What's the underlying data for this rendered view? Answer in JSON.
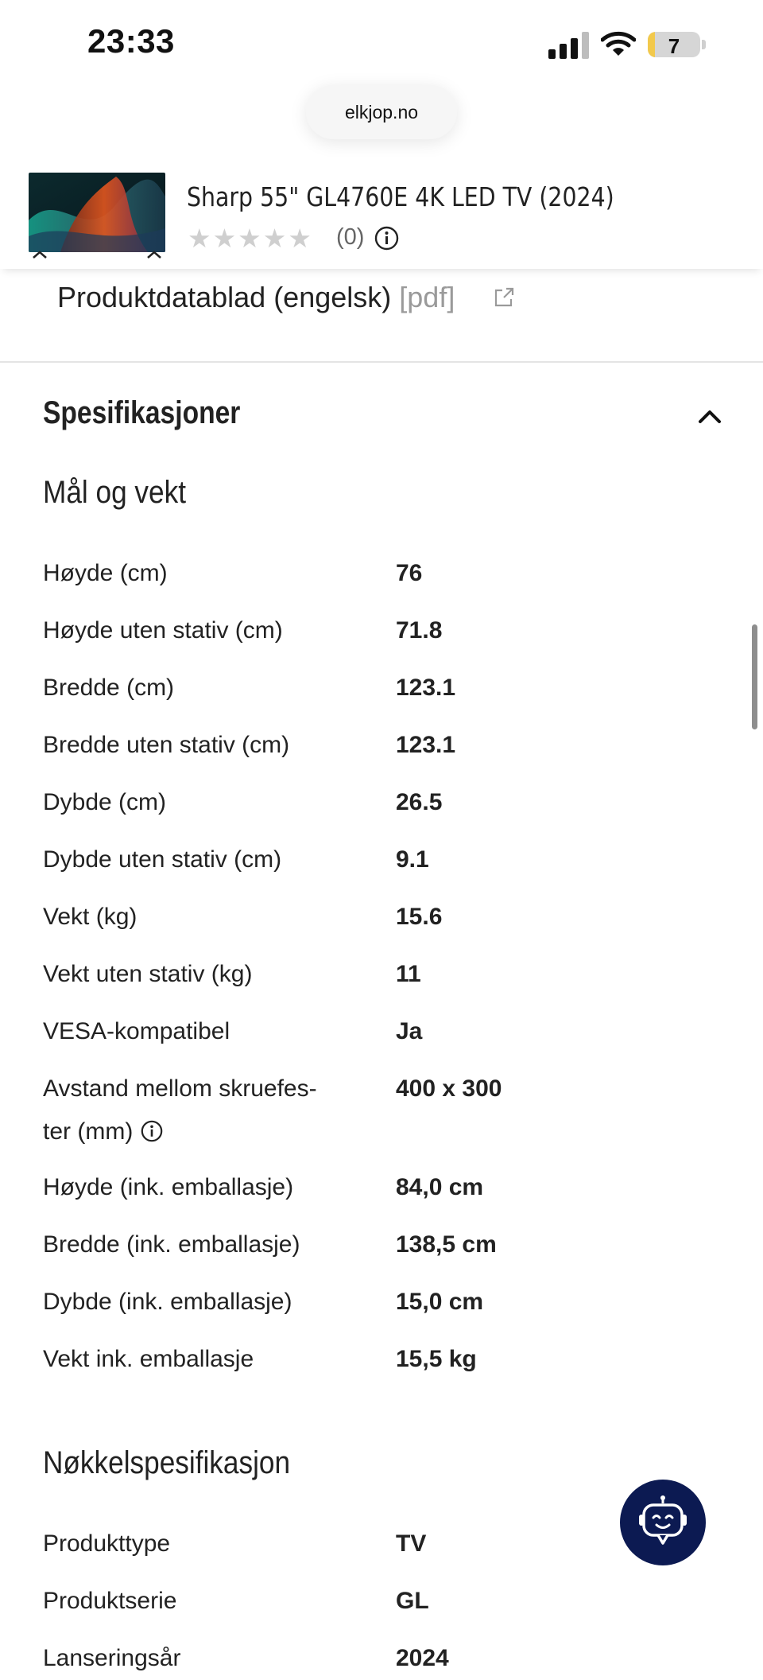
{
  "status_bar": {
    "time": "23:33",
    "battery": "7"
  },
  "browser": {
    "url": "elkjop.no"
  },
  "product": {
    "title": "Sharp 55\" GL4760E 4K LED TV (2024)",
    "stars": "★★★★★",
    "rating_count": "(0)"
  },
  "datasheet": {
    "label": "Produktdatablad (engelsk)",
    "format": "[pdf]"
  },
  "section": {
    "title": "Spesifikasjoner"
  },
  "groups": [
    {
      "title": "Mål og vekt",
      "rows": [
        {
          "label": "Høyde (cm)",
          "value": "76"
        },
        {
          "label": "Høyde uten stativ (cm)",
          "value": "71.8"
        },
        {
          "label": "Bredde (cm)",
          "value": "123.1"
        },
        {
          "label": "Bredde uten stativ (cm)",
          "value": "123.1"
        },
        {
          "label": "Dybde (cm)",
          "value": "26.5"
        },
        {
          "label": "Dybde uten stativ (cm)",
          "value": "9.1"
        },
        {
          "label": "Vekt (kg)",
          "value": "15.6"
        },
        {
          "label": "Vekt uten stativ (kg)",
          "value": "11"
        },
        {
          "label": "VESA-kompatibel",
          "value": "Ja"
        },
        {
          "label_line1": "Avstand mellom skruefes-",
          "label_line2": "ter (mm)",
          "value": "400 x 300"
        },
        {
          "label": "Høyde (ink. emballasje)",
          "value": "84,0 cm"
        },
        {
          "label": "Bredde (ink. emballasje)",
          "value": "138,5 cm"
        },
        {
          "label": "Dybde (ink. emballasje)",
          "value": "15,0 cm"
        },
        {
          "label": "Vekt ink. emballasje",
          "value": "15,5 kg"
        }
      ]
    },
    {
      "title": "Nøkkelspesifikasjon",
      "rows": [
        {
          "label": "Produkttype",
          "value": "TV"
        },
        {
          "label": "Produktserie",
          "value": "GL"
        },
        {
          "label": "Lanseringsår",
          "value": "2024"
        }
      ]
    }
  ],
  "icons": {
    "signal": "cellular-signal-icon",
    "wifi": "wifi-icon",
    "battery": "battery-icon",
    "info": "info-icon",
    "external": "external-link-icon",
    "collapse": "chevron-up-icon",
    "assistant": "chat-bot-icon"
  },
  "colors": {
    "chat_button": "#0c1a52",
    "stars": "#cfcfcf",
    "battery_fill": "#f2c94c"
  }
}
